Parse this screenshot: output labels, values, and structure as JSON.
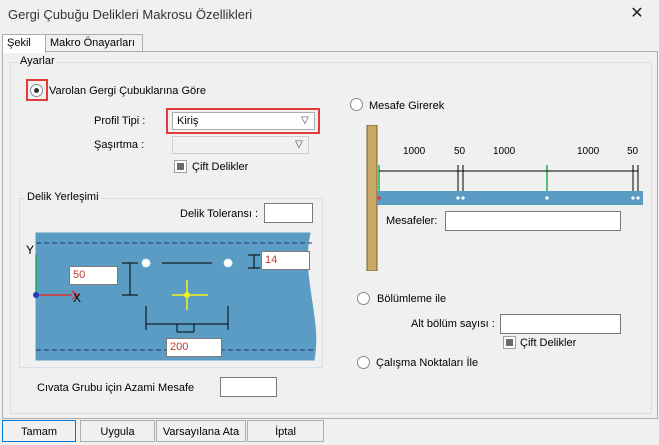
{
  "window": {
    "title": "Gergi Çubuğu Delikleri Makrosu Özellikleri",
    "close_glyph": "✕"
  },
  "tabs": [
    {
      "label": "Şekil"
    },
    {
      "label": "Makro Önayarları"
    }
  ],
  "settings": {
    "group_label": "Ayarlar",
    "option_existing": "Varolan Gergi Çubuklarına Göre",
    "profile_label": "Profil Tipi :",
    "profile_value": "Kiriş",
    "stagger_label": "Şaşırtma :",
    "stagger_value": "",
    "double_holes": "Çift Delikler"
  },
  "hole_placement": {
    "group_label": "Delik Yerleşimi",
    "tolerance_label": "Delik Toleransı :",
    "tolerance_value": "",
    "axis_y": "Y",
    "axis_x": "X",
    "value_50": "50",
    "value_14": "14",
    "value_200": "200"
  },
  "max_distance": {
    "label": "Cıvata Grubu için Azami Mesafe",
    "value": ""
  },
  "distance": {
    "option_label": "Mesafe Girerek",
    "dims": [
      "1000",
      "50",
      "1000",
      "1000",
      "50"
    ],
    "distances_label": "Mesafeler:",
    "distances_value": ""
  },
  "division": {
    "option_label": "Bölümleme ile",
    "subdivision_label": "Alt bölüm sayısı :",
    "subdivision_value": "",
    "double_holes": "Çift Delikler"
  },
  "work_points": {
    "option_label": "Çalışma Noktaları İle"
  },
  "buttons": {
    "ok": "Tamam",
    "apply": "Uygula",
    "defaults": "Varsayılana Ata",
    "cancel": "İptal"
  }
}
